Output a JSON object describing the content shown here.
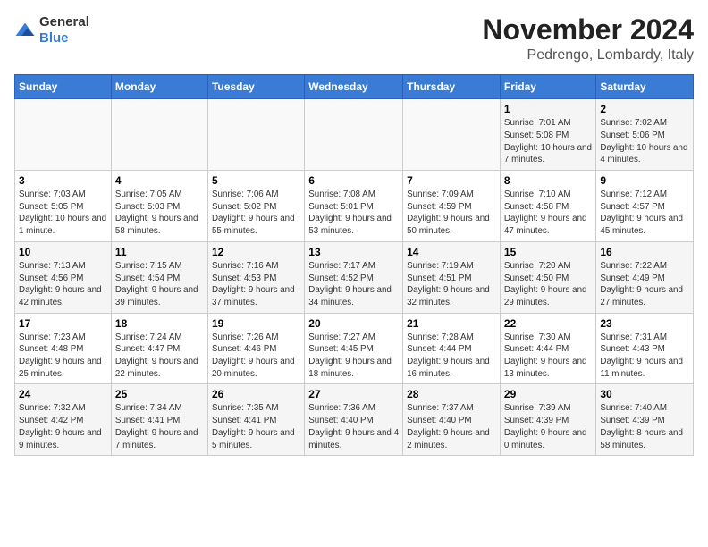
{
  "logo": {
    "general": "General",
    "blue": "Blue"
  },
  "title": "November 2024",
  "location": "Pedrengo, Lombardy, Italy",
  "weekdays": [
    "Sunday",
    "Monday",
    "Tuesday",
    "Wednesday",
    "Thursday",
    "Friday",
    "Saturday"
  ],
  "weeks": [
    [
      {
        "day": "",
        "info": ""
      },
      {
        "day": "",
        "info": ""
      },
      {
        "day": "",
        "info": ""
      },
      {
        "day": "",
        "info": ""
      },
      {
        "day": "",
        "info": ""
      },
      {
        "day": "1",
        "info": "Sunrise: 7:01 AM\nSunset: 5:08 PM\nDaylight: 10 hours and 7 minutes."
      },
      {
        "day": "2",
        "info": "Sunrise: 7:02 AM\nSunset: 5:06 PM\nDaylight: 10 hours and 4 minutes."
      }
    ],
    [
      {
        "day": "3",
        "info": "Sunrise: 7:03 AM\nSunset: 5:05 PM\nDaylight: 10 hours and 1 minute."
      },
      {
        "day": "4",
        "info": "Sunrise: 7:05 AM\nSunset: 5:03 PM\nDaylight: 9 hours and 58 minutes."
      },
      {
        "day": "5",
        "info": "Sunrise: 7:06 AM\nSunset: 5:02 PM\nDaylight: 9 hours and 55 minutes."
      },
      {
        "day": "6",
        "info": "Sunrise: 7:08 AM\nSunset: 5:01 PM\nDaylight: 9 hours and 53 minutes."
      },
      {
        "day": "7",
        "info": "Sunrise: 7:09 AM\nSunset: 4:59 PM\nDaylight: 9 hours and 50 minutes."
      },
      {
        "day": "8",
        "info": "Sunrise: 7:10 AM\nSunset: 4:58 PM\nDaylight: 9 hours and 47 minutes."
      },
      {
        "day": "9",
        "info": "Sunrise: 7:12 AM\nSunset: 4:57 PM\nDaylight: 9 hours and 45 minutes."
      }
    ],
    [
      {
        "day": "10",
        "info": "Sunrise: 7:13 AM\nSunset: 4:56 PM\nDaylight: 9 hours and 42 minutes."
      },
      {
        "day": "11",
        "info": "Sunrise: 7:15 AM\nSunset: 4:54 PM\nDaylight: 9 hours and 39 minutes."
      },
      {
        "day": "12",
        "info": "Sunrise: 7:16 AM\nSunset: 4:53 PM\nDaylight: 9 hours and 37 minutes."
      },
      {
        "day": "13",
        "info": "Sunrise: 7:17 AM\nSunset: 4:52 PM\nDaylight: 9 hours and 34 minutes."
      },
      {
        "day": "14",
        "info": "Sunrise: 7:19 AM\nSunset: 4:51 PM\nDaylight: 9 hours and 32 minutes."
      },
      {
        "day": "15",
        "info": "Sunrise: 7:20 AM\nSunset: 4:50 PM\nDaylight: 9 hours and 29 minutes."
      },
      {
        "day": "16",
        "info": "Sunrise: 7:22 AM\nSunset: 4:49 PM\nDaylight: 9 hours and 27 minutes."
      }
    ],
    [
      {
        "day": "17",
        "info": "Sunrise: 7:23 AM\nSunset: 4:48 PM\nDaylight: 9 hours and 25 minutes."
      },
      {
        "day": "18",
        "info": "Sunrise: 7:24 AM\nSunset: 4:47 PM\nDaylight: 9 hours and 22 minutes."
      },
      {
        "day": "19",
        "info": "Sunrise: 7:26 AM\nSunset: 4:46 PM\nDaylight: 9 hours and 20 minutes."
      },
      {
        "day": "20",
        "info": "Sunrise: 7:27 AM\nSunset: 4:45 PM\nDaylight: 9 hours and 18 minutes."
      },
      {
        "day": "21",
        "info": "Sunrise: 7:28 AM\nSunset: 4:44 PM\nDaylight: 9 hours and 16 minutes."
      },
      {
        "day": "22",
        "info": "Sunrise: 7:30 AM\nSunset: 4:44 PM\nDaylight: 9 hours and 13 minutes."
      },
      {
        "day": "23",
        "info": "Sunrise: 7:31 AM\nSunset: 4:43 PM\nDaylight: 9 hours and 11 minutes."
      }
    ],
    [
      {
        "day": "24",
        "info": "Sunrise: 7:32 AM\nSunset: 4:42 PM\nDaylight: 9 hours and 9 minutes."
      },
      {
        "day": "25",
        "info": "Sunrise: 7:34 AM\nSunset: 4:41 PM\nDaylight: 9 hours and 7 minutes."
      },
      {
        "day": "26",
        "info": "Sunrise: 7:35 AM\nSunset: 4:41 PM\nDaylight: 9 hours and 5 minutes."
      },
      {
        "day": "27",
        "info": "Sunrise: 7:36 AM\nSunset: 4:40 PM\nDaylight: 9 hours and 4 minutes."
      },
      {
        "day": "28",
        "info": "Sunrise: 7:37 AM\nSunset: 4:40 PM\nDaylight: 9 hours and 2 minutes."
      },
      {
        "day": "29",
        "info": "Sunrise: 7:39 AM\nSunset: 4:39 PM\nDaylight: 9 hours and 0 minutes."
      },
      {
        "day": "30",
        "info": "Sunrise: 7:40 AM\nSunset: 4:39 PM\nDaylight: 8 hours and 58 minutes."
      }
    ]
  ]
}
